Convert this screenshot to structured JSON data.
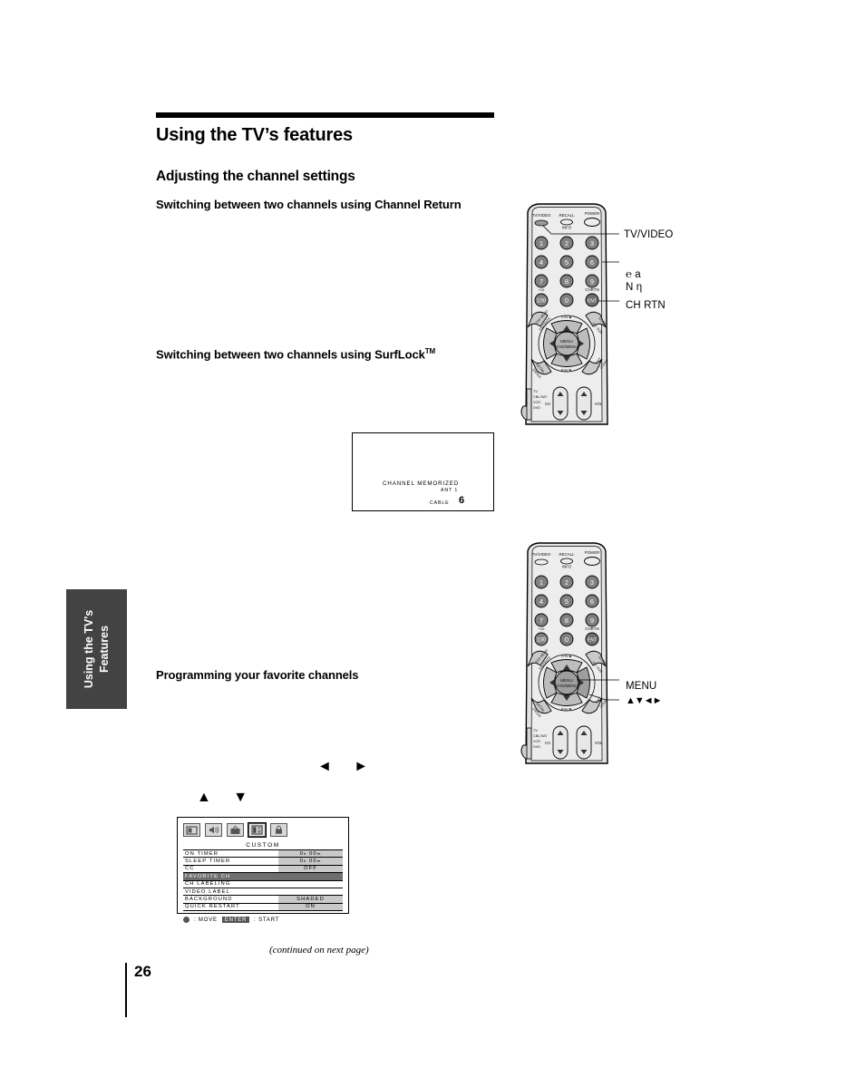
{
  "document": {
    "page_number": "26",
    "continued_note": "(continued on next page)",
    "side_tab": "Using the TV's\nFeatures"
  },
  "headings": {
    "title": "Using the TV’s features",
    "section": "Adjusting the channel settings",
    "sub_1": "Switching between two channels using Channel Return",
    "sub_2": "Switching between two channels using SurfLock",
    "sub_2_tm": "TM",
    "sub_3": "Programming your favorite channels"
  },
  "inline_glyphs": {
    "left_right": "◄ ►",
    "up_down": "▲ ▼"
  },
  "tv_screen": {
    "message": "CHANNEL MEMORIZED",
    "antenna": "ANT 1",
    "source": "CABLE",
    "channel": "6"
  },
  "osd_menu": {
    "title": "CUSTOM",
    "icons": [
      {
        "name": "picture-icon",
        "selected": false
      },
      {
        "name": "audio-icon",
        "selected": false
      },
      {
        "name": "channel-icon",
        "selected": false
      },
      {
        "name": "custom-icon",
        "selected": true
      },
      {
        "name": "lock-icon",
        "selected": false
      }
    ],
    "rows": [
      {
        "label": "ON TIMER",
        "value": "0ₕ 00ₘ",
        "filled": true,
        "highlighted": false
      },
      {
        "label": "SLEEP TIMER",
        "value": "0ₕ 00ₘ",
        "filled": true,
        "highlighted": false
      },
      {
        "label": "CC",
        "value": "OFF",
        "filled": true,
        "highlighted": false
      },
      {
        "label": "FAVORITE CH",
        "value": "",
        "filled": false,
        "highlighted": true
      },
      {
        "label": "CH LABELING",
        "value": "",
        "filled": false,
        "highlighted": false
      },
      {
        "label": "VIDEO LABEL",
        "value": "",
        "filled": false,
        "highlighted": false
      },
      {
        "label": "BACKGROUND",
        "value": "SHADED",
        "filled": true,
        "highlighted": false
      },
      {
        "label": "QUICK RESTART",
        "value": "ON",
        "filled": true,
        "highlighted": false
      }
    ],
    "footer": {
      "move_label": ": MOVE",
      "enter_key": "ENTER",
      "start_label": ": START"
    }
  },
  "remote_top": {
    "buttons": {
      "tv_video": "TV/VIDEO",
      "recall": "RECALL",
      "info": "INFO",
      "power": "POWER",
      "plus_ten": "+10",
      "chrtn": "CHRTN",
      "ent": "ENT",
      "fav_up": "FAV▲",
      "fav_down": "FAV▼",
      "menu": "MENU",
      "dvd_menu": "DVD/MENU",
      "top_menu": "TOP MENU",
      "favorite": "FAVORITE",
      "guide": "GUIDE",
      "pic_size": "PIC SIZE",
      "enter": "ENTER",
      "detail": "DETAIL",
      "exit": "EXIT",
      "clear": "CLEAR",
      "ch": "CH",
      "vol": "VOL"
    },
    "keypad": [
      "1",
      "2",
      "3",
      "4",
      "5",
      "6",
      "7",
      "8",
      "9",
      "100",
      "0",
      "ENT"
    ],
    "mode_switch": [
      "TV",
      "CBL/SAT",
      "VCR",
      "DVD"
    ],
    "callouts": [
      {
        "name": "tv-video",
        "text": "TV/VIDEO"
      },
      {
        "name": "channel-numbers-glyph-line1",
        "text": "℮  a"
      },
      {
        "name": "channel-numbers-glyph-line2",
        "text": "N  η"
      },
      {
        "name": "ch-rtn",
        "text": "CH RTN"
      }
    ]
  },
  "remote_bottom": {
    "callouts": [
      {
        "name": "menu",
        "text": "MENU"
      },
      {
        "name": "direction-pad",
        "text": "▲▼◄►"
      }
    ]
  }
}
